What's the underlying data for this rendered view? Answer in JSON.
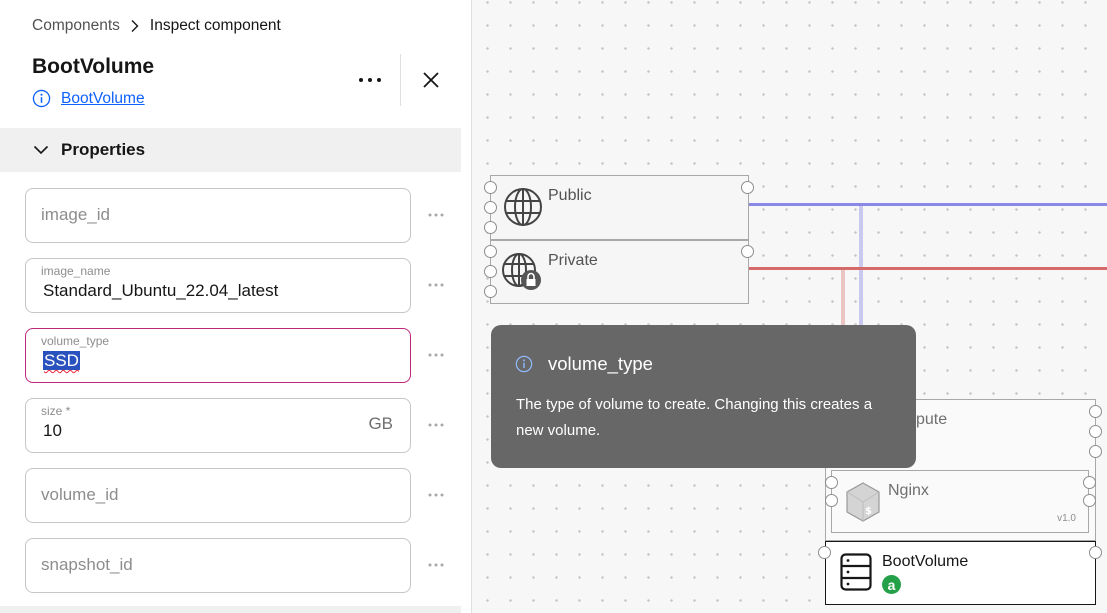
{
  "breadcrumb": {
    "parent": "Components",
    "current": "Inspect component"
  },
  "component": {
    "title": "BootVolume",
    "type_link": "BootVolume"
  },
  "section": {
    "label": "Properties"
  },
  "fields": {
    "image_id": {
      "placeholder": "image_id"
    },
    "image_name": {
      "label": "image_name",
      "value": "Standard_Ubuntu_22.04_latest"
    },
    "volume_type": {
      "label": "volume_type",
      "value": "SSD"
    },
    "size": {
      "label": "size *",
      "value": "10",
      "unit": "GB"
    },
    "volume_id": {
      "placeholder": "volume_id"
    },
    "snapshot_id": {
      "placeholder": "snapshot_id"
    }
  },
  "canvas": {
    "nodes": {
      "public": "Public",
      "private": "Private",
      "compute_partial": "pute",
      "nginx": "Nginx",
      "nginx_version": "v1.0",
      "bootvolume": "BootVolume",
      "bootvolume_badge": "a"
    },
    "wire_colors": {
      "public": "#8a8ae6",
      "private": "#d46a6a"
    }
  },
  "tooltip": {
    "title": "volume_type",
    "body": "The type of volume to create. Changing this creates a new volume."
  },
  "icons": [
    "chevron-right-icon",
    "info-icon",
    "overflow-menu-icon",
    "close-icon",
    "chevron-down-icon",
    "globe-icon",
    "globe-lock-icon",
    "nginx-icon",
    "server-icon"
  ]
}
